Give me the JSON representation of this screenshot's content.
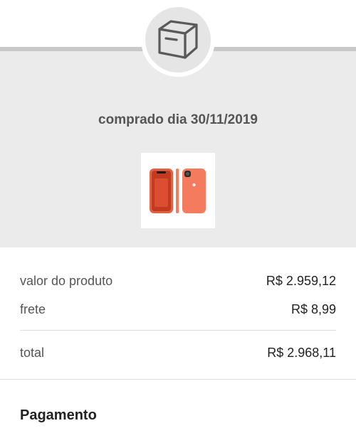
{
  "header": {
    "icon": "package-box-icon",
    "purchase_date": "comprado dia 30/11/2019"
  },
  "product": {
    "image_icon": "phone-product-image",
    "colors": {
      "coral": "#f47b5e",
      "coral_dark": "#e06247",
      "screen": "#c23a1f"
    }
  },
  "summary": {
    "product_value_label": "valor do produto",
    "product_value": "R$ 2.959,12",
    "shipping_label": "frete",
    "shipping_value": "R$ 8,99",
    "total_label": "total",
    "total_value": "R$ 2.968,11"
  },
  "payment": {
    "title": "Pagamento"
  },
  "theme": {
    "gray_background": "#ebebeb",
    "icon_background": "#e5e5e5"
  }
}
